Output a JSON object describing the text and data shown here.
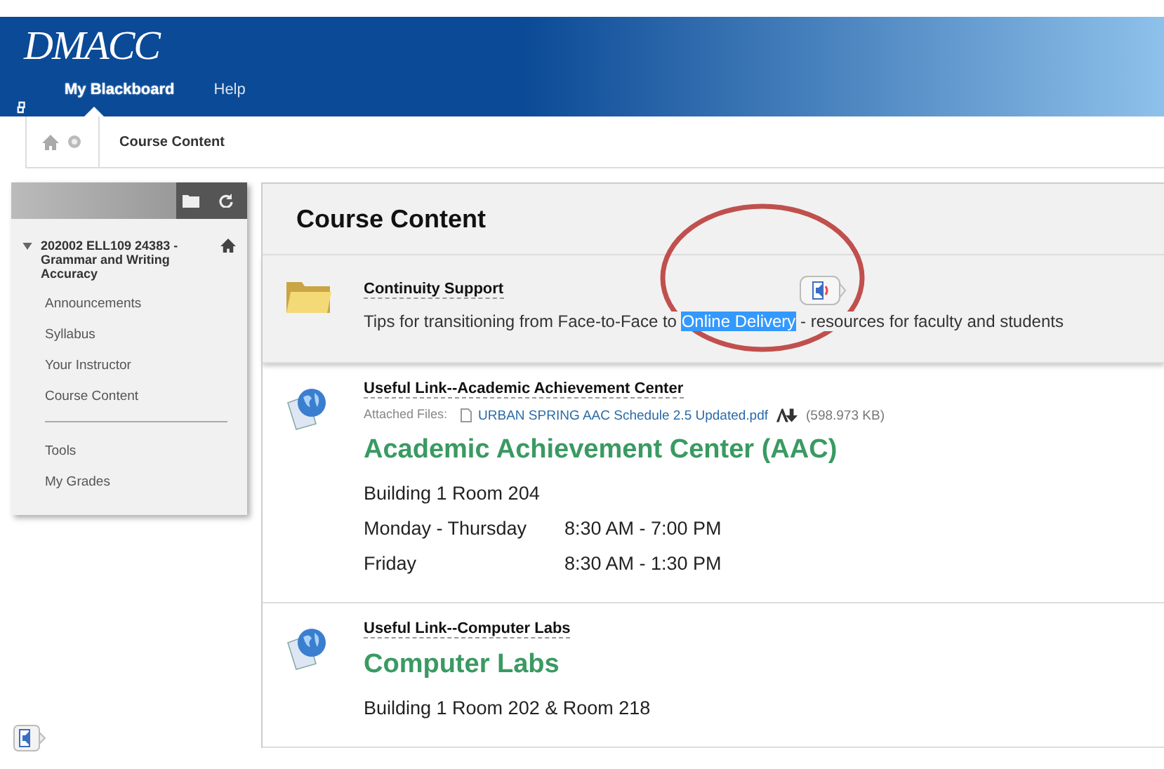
{
  "header": {
    "logo": "DMACC",
    "nav": [
      {
        "label": "My Blackboard",
        "selected": true
      },
      {
        "label": "Help",
        "selected": false
      }
    ]
  },
  "breadcrumb": {
    "items": [
      "Course Content"
    ]
  },
  "sidebar": {
    "course": {
      "title": "202002 ELL109 24383 - Grammar and Writing Accuracy",
      "expanded": true
    },
    "items": [
      "Announcements",
      "Syllabus",
      "Your Instructor",
      "Course Content"
    ],
    "tools": [
      "Tools",
      "My Grades"
    ]
  },
  "page": {
    "title": "Course Content",
    "items": [
      {
        "kind": "folder",
        "title": "Continuity Support",
        "description": [
          {
            "text": "Tips for transitioning from Face-to-Face to ",
            "selected": false
          },
          {
            "text": "Online Delivery",
            "selected": true
          },
          {
            "text": " - resources for faculty and students",
            "selected": false
          }
        ]
      },
      {
        "kind": "link",
        "title": "Useful Link--Academic Achievement Center",
        "attachment": {
          "label": "Attached Files:",
          "file": "URBAN SPRING AAC Schedule 2.5 Updated.pdf",
          "size": "(598.973 KB)"
        },
        "heading": "Academic Achievement Center (AAC)",
        "lines": [
          [
            "Building 1 Room 204"
          ],
          [
            "Monday - Thursday",
            "8:30 AM - 7:00 PM"
          ],
          [
            "Friday",
            "8:30 AM - 1:30 PM"
          ]
        ]
      },
      {
        "kind": "link",
        "title": "Useful Link--Computer Labs",
        "heading": "Computer Labs",
        "lines": [
          [
            "Building 1 Room 202 & Room 218"
          ]
        ]
      }
    ]
  }
}
